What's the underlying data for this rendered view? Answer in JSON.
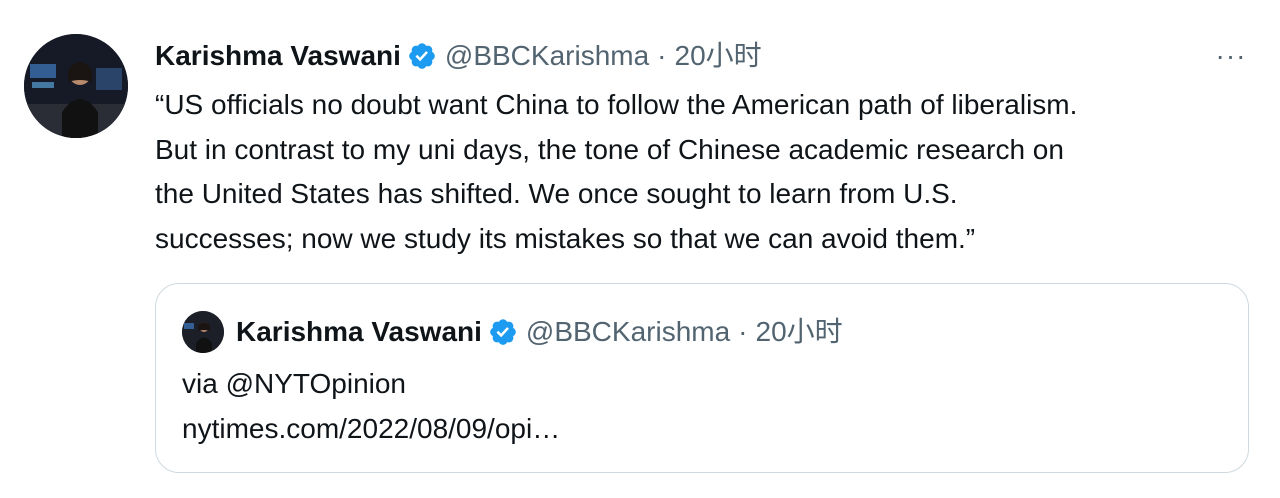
{
  "tweet": {
    "author_name": "Karishma Vaswani",
    "handle": "@BBCKarishma",
    "separator": "·",
    "time": "20小时",
    "more_label": "···",
    "body_lines": [
      "“US officials no doubt want China to follow the American path of liberalism.",
      "But in contrast to my uni days, the tone of Chinese academic research on",
      "the United States has shifted. We once sought to learn from U.S.",
      "successes; now we study its mistakes so that we can avoid them.”"
    ]
  },
  "quoted_tweet": {
    "author_name": "Karishma Vaswani",
    "handle": "@BBCKarishma",
    "separator": "·",
    "time": "20小时",
    "body_lines": [
      "via @NYTOpinion",
      "nytimes.com/2022/08/09/opi…"
    ]
  },
  "colors": {
    "verified_badge": "#1d9bf0",
    "secondary_text": "#536471",
    "border": "#cfd9de"
  },
  "icons": {
    "verified": "verified-badge-icon",
    "more": "more-dots-icon"
  }
}
